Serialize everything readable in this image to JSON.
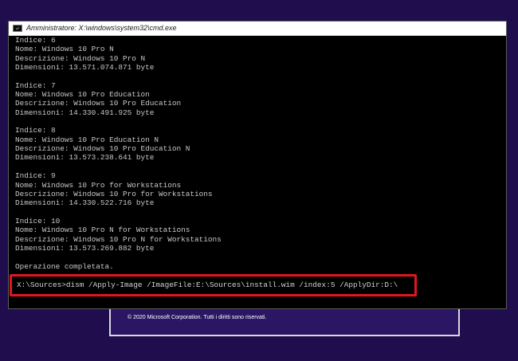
{
  "window": {
    "title": "Amministratore: X:\\windows\\system32\\cmd.exe"
  },
  "console": {
    "lines": [
      "Indice: 6",
      "Nome: Windows 10 Pro N",
      "Descrizione: Windows 10 Pro N",
      "Dimensioni: 13.571.074.871 byte",
      "",
      "Indice: 7",
      "Nome: Windows 10 Pro Education",
      "Descrizione: Windows 10 Pro Education",
      "Dimensioni: 14.330.491.925 byte",
      "",
      "Indice: 8",
      "Nome: Windows 10 Pro Education N",
      "Descrizione: Windows 10 Pro Education N",
      "Dimensioni: 13.573.238.641 byte",
      "",
      "Indice: 9",
      "Nome: Windows 10 Pro for Workstations",
      "Descrizione: Windows 10 Pro for Workstations",
      "Dimensioni: 14.330.522.716 byte",
      "",
      "Indice: 10",
      "Nome: Windows 10 Pro N for Workstations",
      "Descrizione: Windows 10 Pro N for Workstations",
      "Dimensioni: 13.573.269.882 byte",
      "",
      "Operazione completata.",
      ""
    ],
    "command": "X:\\Sources>dism /Apply-Image /ImageFile:E:\\Sources\\install.wim /index:5 /ApplyDir:D:\\"
  },
  "setup": {
    "copyright": "© 2020 Microsoft Corporation. Tutti i diritti sono riservati."
  },
  "colors": {
    "desktop_background": "#1f0d4d",
    "console_background": "#000000",
    "console_text": "#c8c8c8",
    "highlight": "#e3161e"
  },
  "icons": {
    "title_bar": "cmd-icon"
  }
}
